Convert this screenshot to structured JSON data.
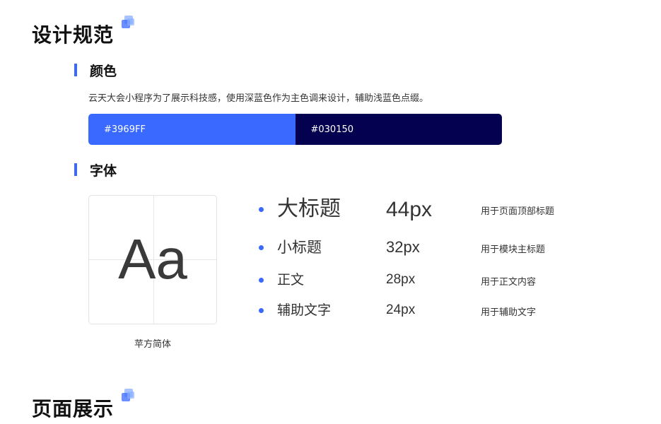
{
  "sections": {
    "design_spec_title": "设计规范",
    "page_display_title": "页面展示"
  },
  "color": {
    "heading": "颜色",
    "description": "云天大会小程序为了展示科技感，使用深蓝色作为主色调来设计，辅助浅蓝色点缀。",
    "swatches": [
      {
        "label": "#3969FF",
        "hex": "#3969FF"
      },
      {
        "label": "#030150",
        "hex": "#030150"
      }
    ]
  },
  "font": {
    "heading": "字体",
    "sample": "Aa",
    "family_name": "苹方简体",
    "levels": [
      {
        "name": "大标题",
        "size": "44px",
        "usage": "用于页面顶部标题"
      },
      {
        "name": "小标题",
        "size": "32px",
        "usage": "用于模块主标题"
      },
      {
        "name": "正文",
        "size": "28px",
        "usage": "用于正文内容"
      },
      {
        "name": "辅助文字",
        "size": "24px",
        "usage": "用于辅助文字"
      }
    ]
  },
  "accent_color": "#3969FF"
}
